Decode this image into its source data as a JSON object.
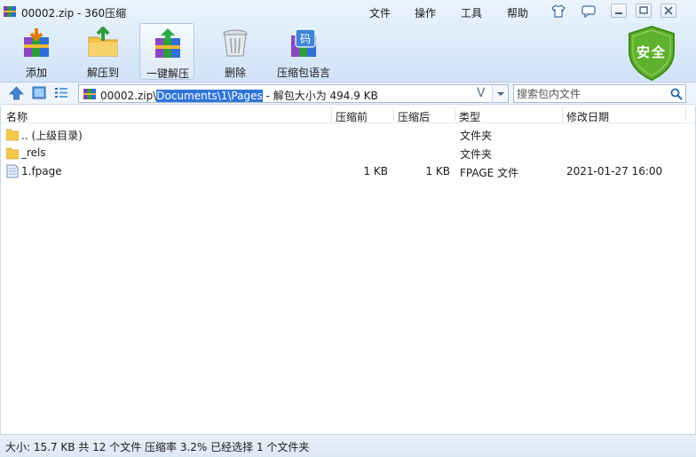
{
  "window": {
    "title": "00002.zip - 360压缩",
    "menu": [
      "文件",
      "操作",
      "工具",
      "帮助"
    ]
  },
  "toolbar": {
    "add": "添加",
    "extract_to": "解压到",
    "one_click_extract": "一键解压",
    "delete": "删除",
    "comment_language": "压缩包语言"
  },
  "security_badge": "安全",
  "address": {
    "prefix": "00002.zip\\",
    "selected": "Documents\\1\\Pages",
    "suffix": " - 解包大小为 494.9 KB",
    "mark": "V"
  },
  "search": {
    "placeholder": "搜索包内文件"
  },
  "columns": {
    "name": "名称",
    "packed": "压缩前",
    "unpacked": "压缩后",
    "type": "类型",
    "modified": "修改日期"
  },
  "rows": [
    {
      "name": ".. (上级目录)",
      "packed": "",
      "unpacked": "",
      "type": "文件夹",
      "modified": ""
    },
    {
      "name": "_rels",
      "packed": "",
      "unpacked": "",
      "type": "文件夹",
      "modified": ""
    },
    {
      "name": "1.fpage",
      "packed": "1 KB",
      "unpacked": "1 KB",
      "type": "FPAGE 文件",
      "modified": "2021-01-27 16:00"
    }
  ],
  "status": "大小: 15.7 KB 共 12 个文件 压缩率 3.2% 已经选择 1 个文件夹",
  "colors": {
    "selection": "#3075d8",
    "shield": "#5fb22d",
    "folder": "#f7c948"
  }
}
